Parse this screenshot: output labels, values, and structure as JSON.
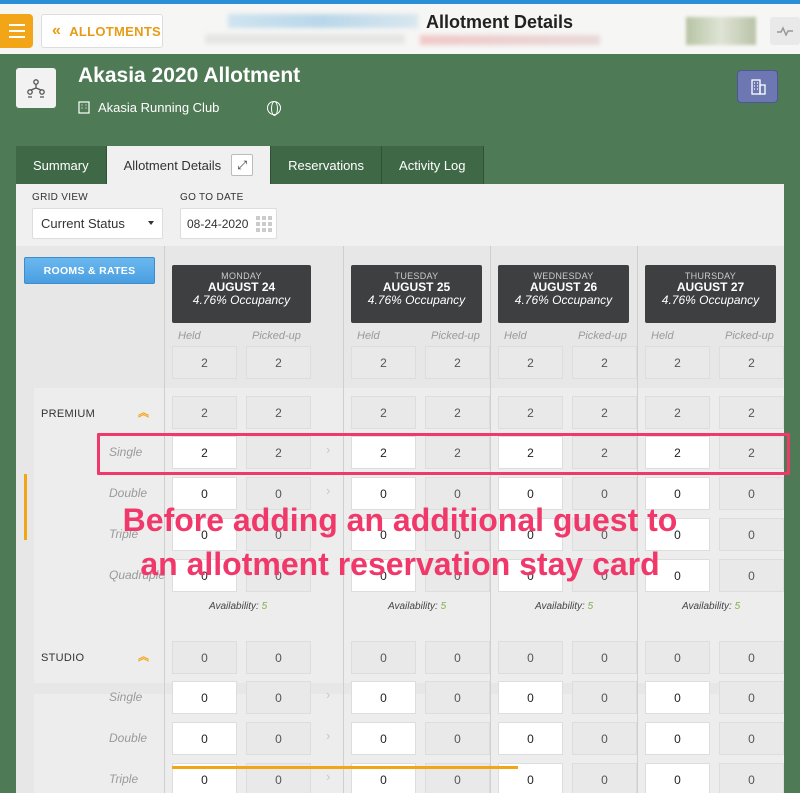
{
  "topbar": {
    "back_label": "ALLOTMENTS",
    "title": "Allotment Details"
  },
  "group": {
    "name": "Akasia 2020 Allotment",
    "organization": "Akasia Running Club"
  },
  "tabs": [
    {
      "label": "Summary"
    },
    {
      "label": "Allotment Details"
    },
    {
      "label": "Reservations"
    },
    {
      "label": "Activity Log"
    }
  ],
  "controls": {
    "grid_view_label": "GRID VIEW",
    "grid_view_value": "Current Status",
    "go_to_date_label": "GO TO DATE",
    "go_to_date_value": "08-24-2020",
    "rooms_rates_label": "ROOMS & RATES"
  },
  "days": [
    {
      "dow": "MONDAY",
      "date": "AUGUST 24",
      "occupancy": "4.76% Occupancy",
      "held_label": "Held",
      "picked_label": "Picked-up"
    },
    {
      "dow": "TUESDAY",
      "date": "AUGUST 25",
      "occupancy": "4.76% Occupancy",
      "held_label": "Held",
      "picked_label": "Picked-up"
    },
    {
      "dow": "WEDNESDAY",
      "date": "AUGUST 26",
      "occupancy": "4.76% Occupancy",
      "held_label": "Held",
      "picked_label": "Picked-up"
    },
    {
      "dow": "THURSDAY",
      "date": "AUGUST 27",
      "occupancy": "4.76% Occupancy",
      "held_label": "Held",
      "picked_label": "Picked-up"
    }
  ],
  "totals": [
    "2",
    "2",
    "2",
    "2",
    "2",
    "2",
    "2",
    "2"
  ],
  "premium": {
    "label": "PREMIUM",
    "summary": [
      "2",
      "2",
      "2",
      "2",
      "2",
      "2",
      "2",
      "2"
    ],
    "rows": [
      {
        "label": "Single",
        "values": [
          "2",
          "2",
          "2",
          "2",
          "2",
          "2",
          "2",
          "2"
        ]
      },
      {
        "label": "Double",
        "values": [
          "0",
          "0",
          "0",
          "0",
          "0",
          "0",
          "0",
          "0"
        ]
      },
      {
        "label": "Triple",
        "values": [
          "0",
          "0",
          "0",
          "0",
          "0",
          "0",
          "0",
          "0"
        ]
      },
      {
        "label": "Quadruple",
        "values": [
          "0",
          "0",
          "0",
          "0",
          "0",
          "0",
          "0",
          "0"
        ]
      }
    ],
    "availability_label": "Availability:",
    "availability": [
      "5",
      "5",
      "5",
      "5"
    ]
  },
  "studio": {
    "label": "STUDIO",
    "summary": [
      "0",
      "0",
      "0",
      "0",
      "0",
      "0",
      "0",
      "0"
    ],
    "rows": [
      {
        "label": "Single",
        "values": [
          "0",
          "0",
          "0",
          "0",
          "0",
          "0",
          "0",
          "0"
        ]
      },
      {
        "label": "Double",
        "values": [
          "0",
          "0",
          "0",
          "0",
          "0",
          "0",
          "0",
          "0"
        ]
      },
      {
        "label": "Triple",
        "values": [
          "0",
          "0",
          "0",
          "0",
          "0",
          "0",
          "0",
          "0"
        ]
      }
    ]
  },
  "annotation": {
    "line1": "Before adding an additional guest to",
    "line2": "an allotment reservation stay card"
  },
  "colors": {
    "background": "#4f7a56",
    "accent_orange": "#f2a516",
    "annotation_pink": "#f0396a",
    "availability_green": "#7fb04b"
  }
}
